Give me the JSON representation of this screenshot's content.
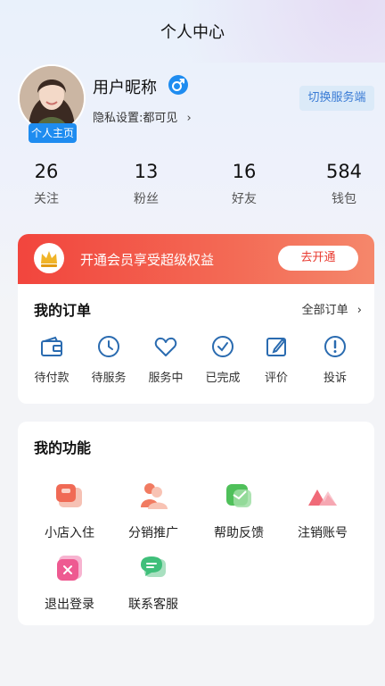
{
  "header": {
    "title": "个人中心"
  },
  "profile": {
    "nickname": "用户昵称",
    "privacy": "隐私设置:都可见",
    "home_badge": "个人主页",
    "switch_button": "切换服务端"
  },
  "stats": [
    {
      "value": "26",
      "label": "关注"
    },
    {
      "value": "13",
      "label": "粉丝"
    },
    {
      "value": "16",
      "label": "好友"
    },
    {
      "value": "584",
      "label": "钱包"
    }
  ],
  "vip": {
    "text": "开通会员享受超级权益",
    "button": "去开通"
  },
  "orders": {
    "title": "我的订单",
    "all_label": "全部订单",
    "items": [
      {
        "label": "待付款",
        "icon": "wallet-icon"
      },
      {
        "label": "待服务",
        "icon": "clock-icon"
      },
      {
        "label": "服务中",
        "icon": "heart-icon"
      },
      {
        "label": "已完成",
        "icon": "check-circle-icon"
      },
      {
        "label": "评价",
        "icon": "edit-icon"
      },
      {
        "label": "投诉",
        "icon": "alert-icon"
      }
    ]
  },
  "functions": {
    "title": "我的功能",
    "items": [
      {
        "label": "小店入住",
        "icon": "shop-icon"
      },
      {
        "label": "分销推广",
        "icon": "people-icon"
      },
      {
        "label": "帮助反馈",
        "icon": "feedback-icon"
      },
      {
        "label": "注销账号",
        "icon": "mountain-icon"
      },
      {
        "label": "退出登录",
        "icon": "logout-icon"
      },
      {
        "label": "联系客服",
        "icon": "chat-icon"
      }
    ]
  },
  "colors": {
    "accent": "#1e8cf0",
    "vip_red": "#f2453d",
    "icon_blue": "#2a6bb0"
  }
}
